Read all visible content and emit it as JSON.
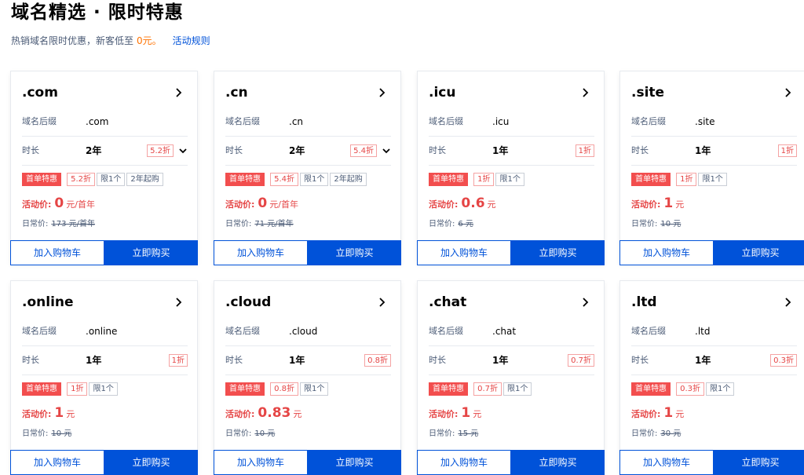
{
  "header": {
    "title": "域名精选 · 限时特惠",
    "subtitle_prefix": "热销域名限时优惠，新客低至",
    "subtitle_price": "0元。",
    "rules_link": "活动规则"
  },
  "labels": {
    "suffix": "域名后缀",
    "duration": "时长",
    "promo_tag": "首单特惠",
    "activity_price": "活动价:",
    "regular_price": "日常价:",
    "add_cart": "加入购物车",
    "buy_now": "立即购买"
  },
  "cards": [
    {
      "title": ".com",
      "suffix": ".com",
      "duration": "2年",
      "discount": "5.2折",
      "has_dropdown": true,
      "tags": [
        {
          "text": "5.2折",
          "style": "red"
        },
        {
          "text": "限1个",
          "style": "gray"
        },
        {
          "text": "2年起购",
          "style": "gray"
        }
      ],
      "price": "0",
      "price_unit": "元/首年",
      "regular": "173 元/首年"
    },
    {
      "title": ".cn",
      "suffix": ".cn",
      "duration": "2年",
      "discount": "5.4折",
      "has_dropdown": true,
      "tags": [
        {
          "text": "5.4折",
          "style": "red"
        },
        {
          "text": "限1个",
          "style": "gray"
        },
        {
          "text": "2年起购",
          "style": "gray"
        }
      ],
      "price": "0",
      "price_unit": "元/首年",
      "regular": "71 元/首年"
    },
    {
      "title": ".icu",
      "suffix": ".icu",
      "duration": "1年",
      "discount": "1折",
      "has_dropdown": false,
      "tags": [
        {
          "text": "1折",
          "style": "red"
        },
        {
          "text": "限1个",
          "style": "gray"
        }
      ],
      "price": "0.6",
      "price_unit": "元",
      "regular": "6 元"
    },
    {
      "title": ".site",
      "suffix": ".site",
      "duration": "1年",
      "discount": "1折",
      "has_dropdown": false,
      "tags": [
        {
          "text": "1折",
          "style": "red"
        },
        {
          "text": "限1个",
          "style": "gray"
        }
      ],
      "price": "1",
      "price_unit": "元",
      "regular": "10 元"
    },
    {
      "title": ".online",
      "suffix": ".online",
      "duration": "1年",
      "discount": "1折",
      "has_dropdown": false,
      "tags": [
        {
          "text": "1折",
          "style": "red"
        },
        {
          "text": "限1个",
          "style": "gray"
        }
      ],
      "price": "1",
      "price_unit": "元",
      "regular": "10 元"
    },
    {
      "title": ".cloud",
      "suffix": ".cloud",
      "duration": "1年",
      "discount": "0.8折",
      "has_dropdown": false,
      "tags": [
        {
          "text": "0.8折",
          "style": "red"
        },
        {
          "text": "限1个",
          "style": "gray"
        }
      ],
      "price": "0.83",
      "price_unit": "元",
      "regular": "10 元"
    },
    {
      "title": ".chat",
      "suffix": ".chat",
      "duration": "1年",
      "discount": "0.7折",
      "has_dropdown": false,
      "tags": [
        {
          "text": "0.7折",
          "style": "red"
        },
        {
          "text": "限1个",
          "style": "gray"
        }
      ],
      "price": "1",
      "price_unit": "元",
      "regular": "15 元"
    },
    {
      "title": ".ltd",
      "suffix": ".ltd",
      "duration": "1年",
      "discount": "0.3折",
      "has_dropdown": false,
      "tags": [
        {
          "text": "0.3折",
          "style": "red"
        },
        {
          "text": "限1个",
          "style": "gray"
        }
      ],
      "price": "1",
      "price_unit": "元",
      "regular": "30 元"
    }
  ]
}
